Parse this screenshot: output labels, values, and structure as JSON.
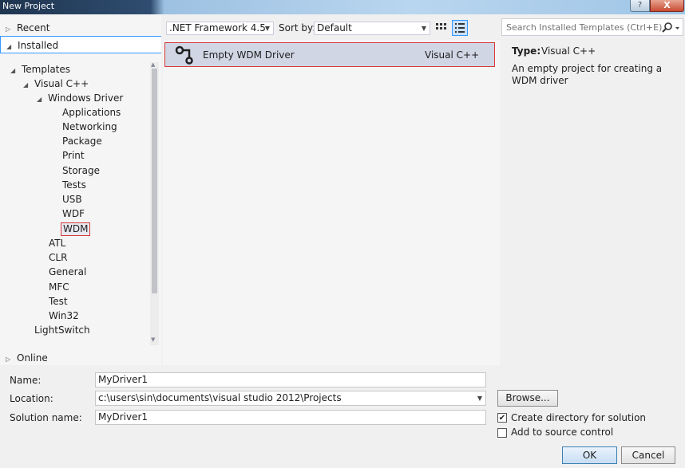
{
  "window": {
    "title": "New Project",
    "help_label": "?",
    "close_label": "X"
  },
  "left": {
    "recent": "Recent",
    "installed": "Installed",
    "online": "Online",
    "tree": {
      "templates": "Templates",
      "visual_cpp": "Visual C++",
      "windows_driver": "Windows Driver",
      "driver_children": [
        "Applications",
        "Networking",
        "Package",
        "Print",
        "Storage",
        "Tests",
        "USB",
        "WDF",
        "WDM"
      ],
      "cpp_children": [
        "ATL",
        "CLR",
        "General",
        "MFC",
        "Test",
        "Win32"
      ],
      "lightswitch": "LightSwitch"
    }
  },
  "toolbar": {
    "framework": ".NET Framework 4.5",
    "sort_label": "Sort by:",
    "sort_value": "Default"
  },
  "templates": [
    {
      "name": "Empty WDM Driver",
      "language": "Visual C++"
    }
  ],
  "details": {
    "search_placeholder": "Search Installed Templates (Ctrl+E)",
    "type_label": "Type:",
    "type_value": "Visual C++",
    "description": "An empty project for creating a WDM driver"
  },
  "form": {
    "name_label": "Name:",
    "name_value": "MyDriver1",
    "location_label": "Location:",
    "location_value": "c:\\users\\sin\\documents\\visual studio 2012\\Projects",
    "solution_label": "Solution name:",
    "solution_value": "MyDriver1",
    "browse_label": "Browse...",
    "create_dir_label": "Create directory for solution",
    "create_dir_checked": true,
    "source_control_label": "Add to source control",
    "source_control_checked": false,
    "ok_label": "OK",
    "cancel_label": "Cancel"
  }
}
